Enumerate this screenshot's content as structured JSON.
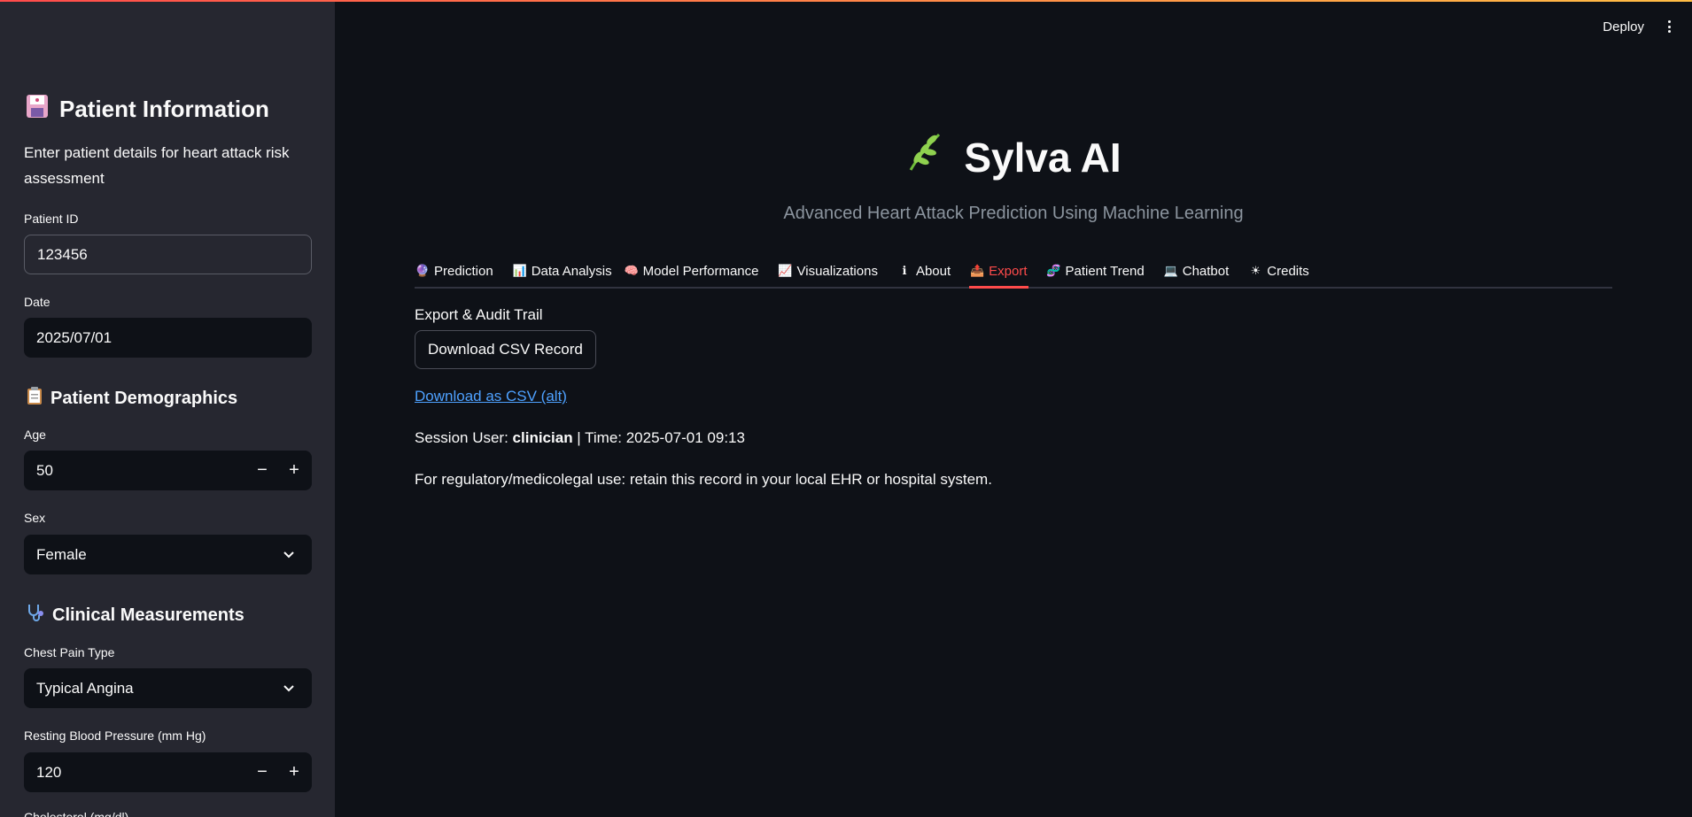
{
  "colors": {
    "accent": "#ff4b4b",
    "link": "#4ea1ff",
    "sidebar_bg": "#262730",
    "main_bg": "#0e1117"
  },
  "header": {
    "deploy_label": "Deploy",
    "menu_icon": "kebab-menu-icon"
  },
  "sidebar": {
    "title": "Patient Information",
    "title_icon": "floppy-disk-icon",
    "description": "Enter patient details for heart attack risk assessment",
    "patient_id": {
      "label": "Patient ID",
      "value": "123456"
    },
    "date": {
      "label": "Date",
      "value": "2025/07/01"
    },
    "demographics": {
      "title": "Patient Demographics",
      "icon": "clipboard-icon"
    },
    "age": {
      "label": "Age",
      "value": "50",
      "minus": "−",
      "plus": "+"
    },
    "sex": {
      "label": "Sex",
      "value": "Female"
    },
    "clinical": {
      "title": "Clinical Measurements",
      "icon": "stethoscope-icon"
    },
    "chest_pain": {
      "label": "Chest Pain Type",
      "value": "Typical Angina"
    },
    "resting_bp": {
      "label": "Resting Blood Pressure (mm Hg)",
      "value": "120",
      "minus": "−",
      "plus": "+"
    },
    "cholesterol_partial_label": "Cholesterol (mg/dl)"
  },
  "main": {
    "title": "Sylva AI",
    "title_icon": "leaf-icon",
    "subtitle": "Advanced Heart Attack Prediction Using Machine Learning",
    "tabs": [
      {
        "label": "Prediction",
        "icon": "crystal-ball-icon",
        "glyph": "🔮"
      },
      {
        "label": "Data Analysis",
        "icon": "bar-chart-icon",
        "glyph": "📊"
      },
      {
        "label": "Model Performance",
        "icon": "brain-icon",
        "glyph": "🧠"
      },
      {
        "label": "Visualizations",
        "icon": "line-chart-icon",
        "glyph": "📈"
      },
      {
        "label": "About",
        "icon": "info-icon",
        "glyph": "ℹ"
      },
      {
        "label": "Export",
        "icon": "inbox-tray-icon",
        "glyph": "📤"
      },
      {
        "label": "Patient Trend",
        "icon": "dna-icon",
        "glyph": "🧬"
      },
      {
        "label": "Chatbot",
        "icon": "laptop-icon",
        "glyph": "💻"
      },
      {
        "label": "Credits",
        "icon": "sun-icon",
        "glyph": "☀"
      }
    ],
    "active_tab": "Export",
    "export": {
      "section_label": "Export & Audit Trail",
      "download_button": "Download CSV Record",
      "alt_link": "Download as CSV (alt)",
      "session_prefix": "Session User: ",
      "session_user": "clinician",
      "session_suffix": " | Time: 2025-07-01 09:13",
      "note": "For regulatory/medicolegal use: retain this record in your local EHR or hospital system."
    }
  }
}
